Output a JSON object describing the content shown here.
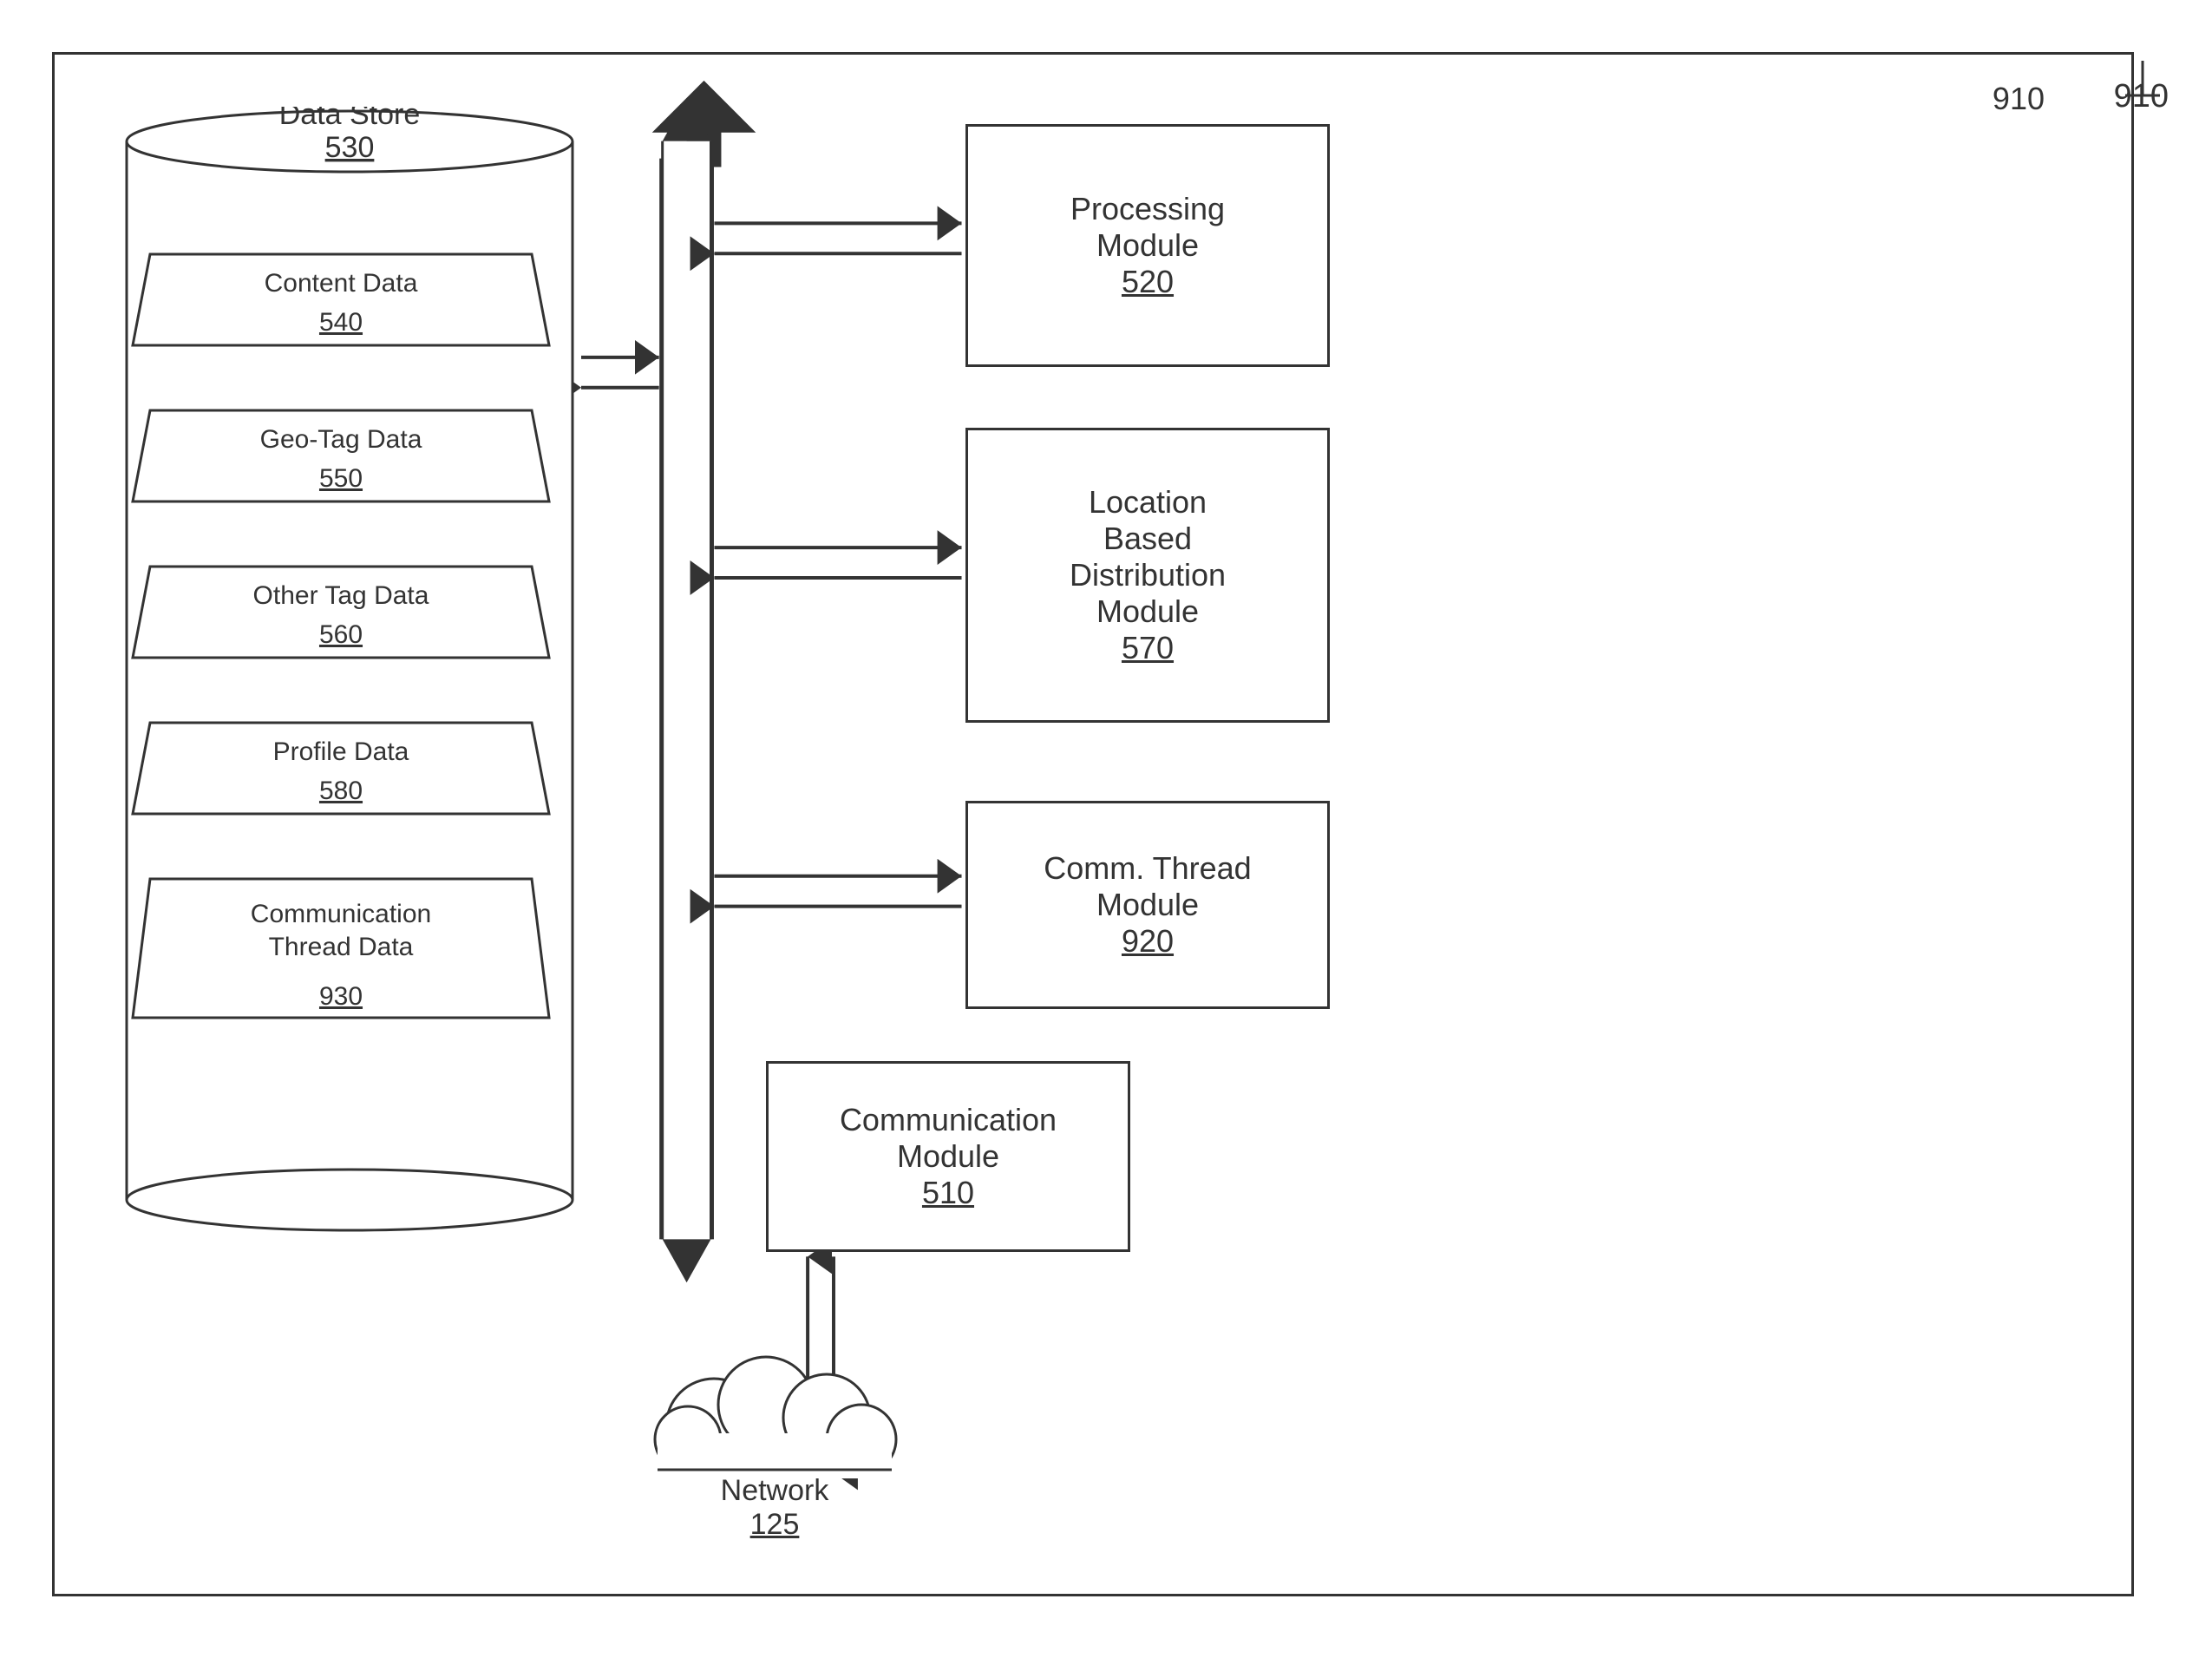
{
  "diagram": {
    "ref": "910",
    "dataStore": {
      "label": "Data Store",
      "num": "530"
    },
    "items": [
      {
        "label": "Content Data",
        "num": "540"
      },
      {
        "label": "Geo-Tag Data",
        "num": "550"
      },
      {
        "label": "Other Tag Data",
        "num": "560"
      },
      {
        "label": "Profile Data",
        "num": "580"
      },
      {
        "label": "Communication\nThread Data",
        "num": "930"
      }
    ],
    "modules": {
      "processing": {
        "label": "Processing\nModule",
        "num": "520"
      },
      "location": {
        "label": "Location\nBased\nDistribution\nModule",
        "num": "570"
      },
      "commThread": {
        "label": "Comm. Thread\nModule",
        "num": "920"
      },
      "comm": {
        "label": "Communication\nModule",
        "num": "510"
      }
    },
    "network": {
      "label": "Network",
      "num": "125"
    }
  }
}
